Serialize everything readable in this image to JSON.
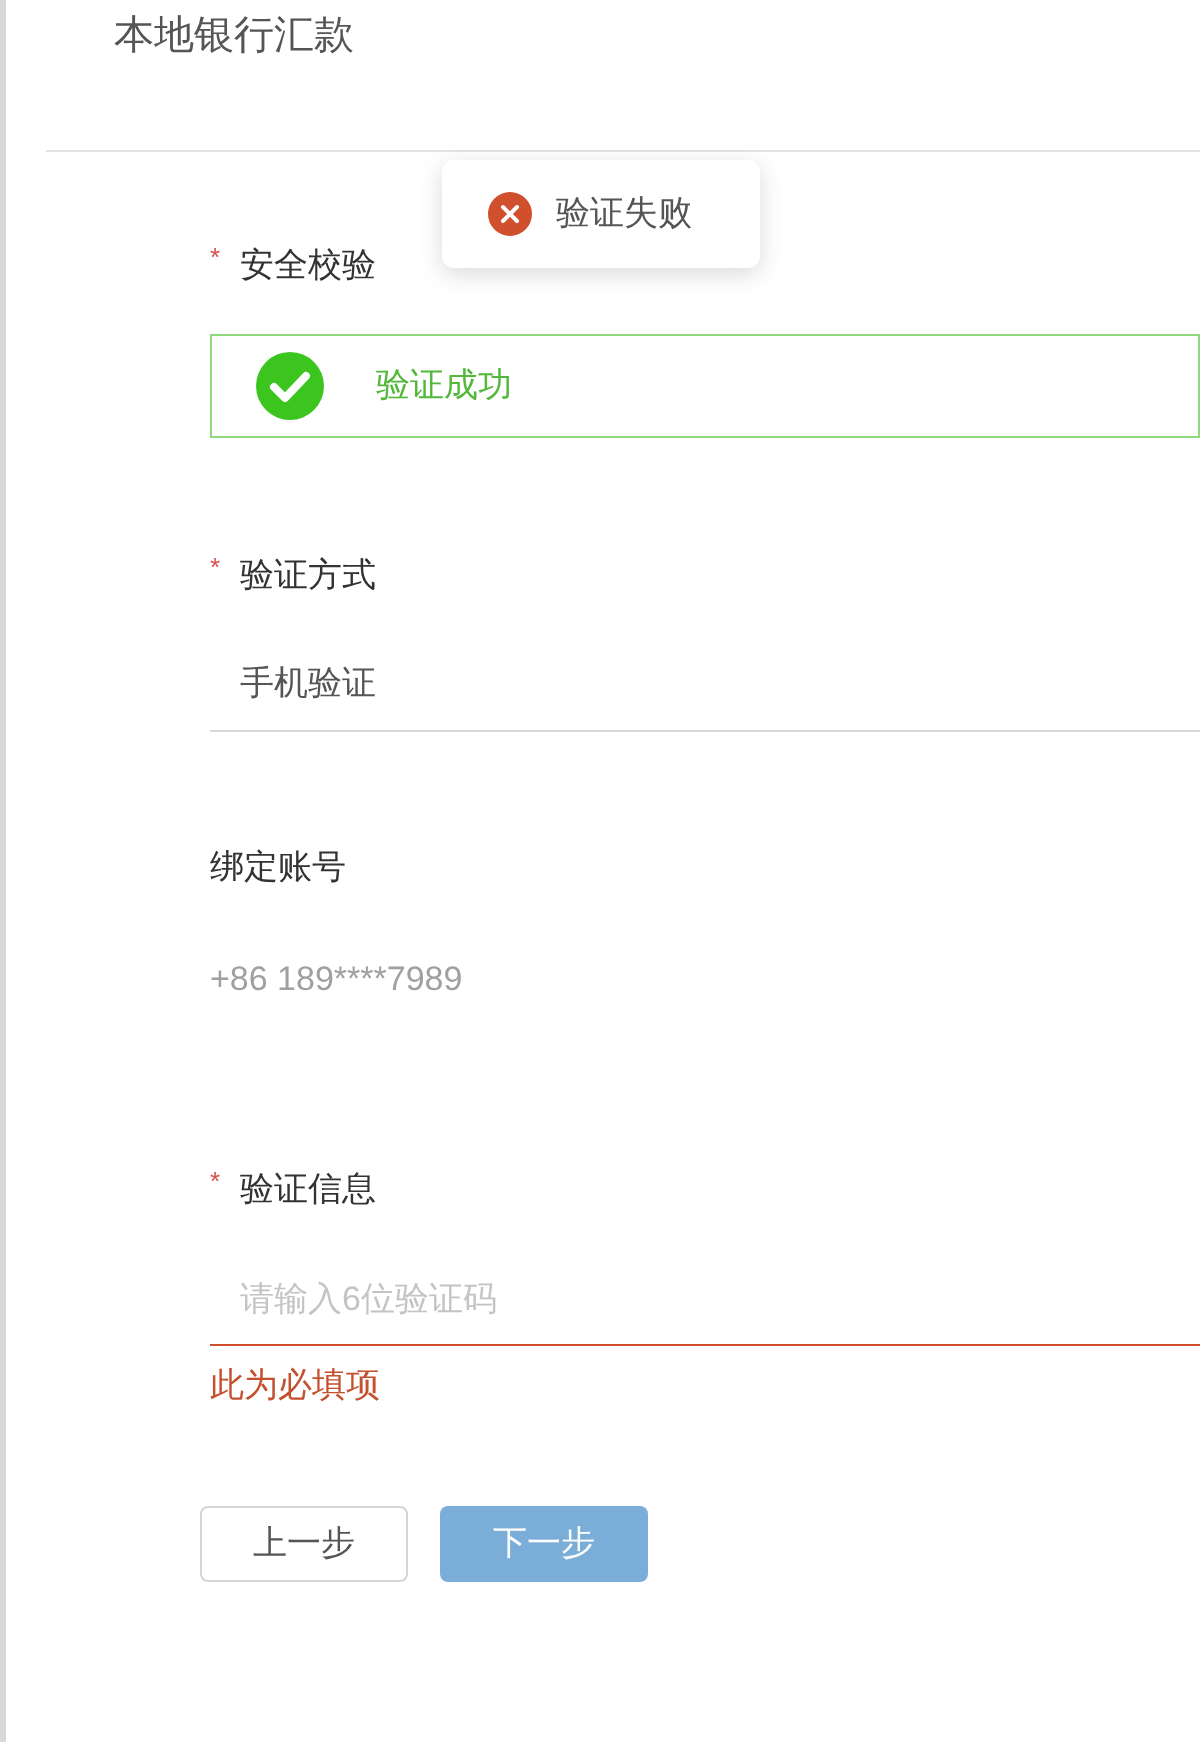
{
  "page_title": "本地银行汇款",
  "toast": {
    "kind": "error",
    "text": "验证失败"
  },
  "fields": [
    {
      "kind": "verify",
      "required_mark": "*",
      "label": "安全校验",
      "success": true,
      "value": "验证成功"
    },
    {
      "kind": "select",
      "required_mark": "*",
      "label": "验证方式",
      "value": "手机验证"
    },
    {
      "kind": "text",
      "label": "绑定账号",
      "value": "+86 189****7989"
    },
    {
      "kind": "input",
      "required_mark": "*",
      "label": "验证信息",
      "placeholder": "请输入6位验证码",
      "error": "此为必填项"
    }
  ],
  "buttons": [
    {
      "label": "上一步",
      "kind": "secondary",
      "disabled": false
    },
    {
      "label": "下一步",
      "kind": "primary",
      "disabled": true
    }
  ]
}
